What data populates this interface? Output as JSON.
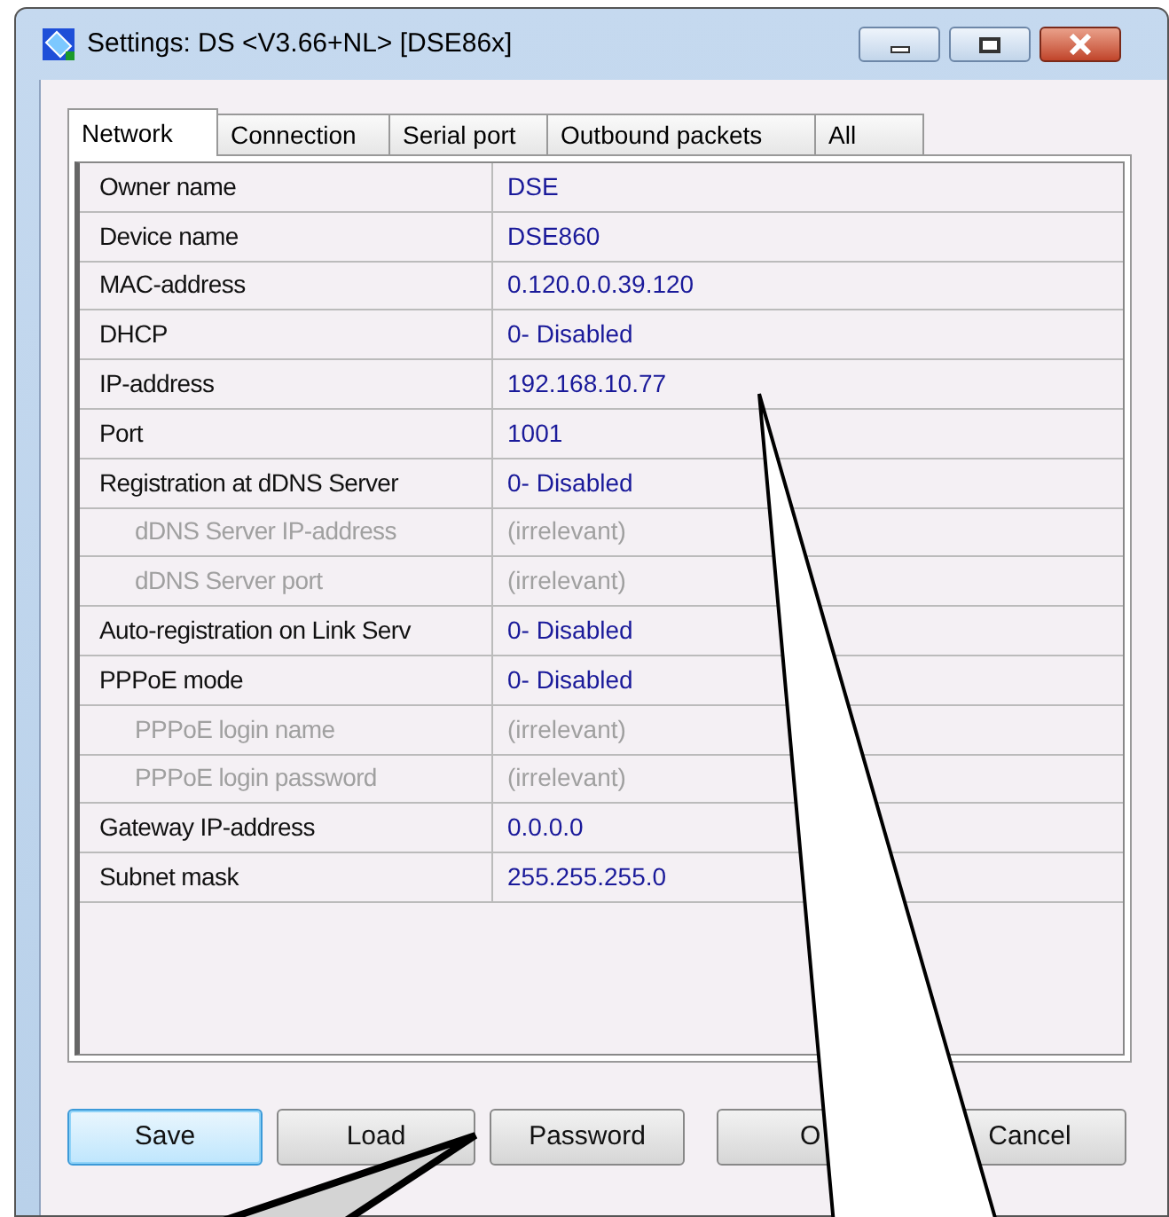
{
  "window": {
    "title": "Settings: DS <V3.66+NL> [DSE86x]"
  },
  "tabs": [
    {
      "label": "Network",
      "selected": true
    },
    {
      "label": "Connection",
      "selected": false
    },
    {
      "label": "Serial port",
      "selected": false
    },
    {
      "label": "Outbound packets",
      "selected": false
    },
    {
      "label": "All",
      "selected": false
    }
  ],
  "settings": [
    {
      "name": "Owner name",
      "value": "DSE",
      "kind": "normal"
    },
    {
      "name": "Device name",
      "value": "DSE860",
      "kind": "normal"
    },
    {
      "name": "MAC-address",
      "value": "0.120.0.0.39.120",
      "kind": "normal"
    },
    {
      "name": "DHCP",
      "value": "0- Disabled",
      "kind": "normal"
    },
    {
      "name": "IP-address",
      "value": "192.168.10.77",
      "kind": "normal"
    },
    {
      "name": "Port",
      "value": "1001",
      "kind": "normal"
    },
    {
      "name": "Registration at dDNS Server",
      "value": "0- Disabled",
      "kind": "normal"
    },
    {
      "name": "dDNS Server IP-address",
      "value": "(irrelevant)",
      "kind": "sub"
    },
    {
      "name": "dDNS Server port",
      "value": "(irrelevant)",
      "kind": "sub"
    },
    {
      "name": "Auto-registration on Link Serv",
      "value": "0- Disabled",
      "kind": "normal"
    },
    {
      "name": "PPPoE mode",
      "value": "0- Disabled",
      "kind": "normal"
    },
    {
      "name": "PPPoE login name",
      "value": "(irrelevant)",
      "kind": "sub"
    },
    {
      "name": "PPPoE login password",
      "value": "(irrelevant)",
      "kind": "sub"
    },
    {
      "name": "Gateway IP-address",
      "value": "0.0.0.0",
      "kind": "normal"
    },
    {
      "name": "Subnet mask",
      "value": "255.255.255.0",
      "kind": "normal"
    }
  ],
  "buttons": [
    {
      "label": "Save",
      "kind": "default"
    },
    {
      "label": "Load",
      "kind": "normal"
    },
    {
      "label": "Password",
      "kind": "normal"
    },
    {
      "label": "O",
      "kind": "covered"
    },
    {
      "label": "Cancel",
      "kind": "normal"
    }
  ]
}
